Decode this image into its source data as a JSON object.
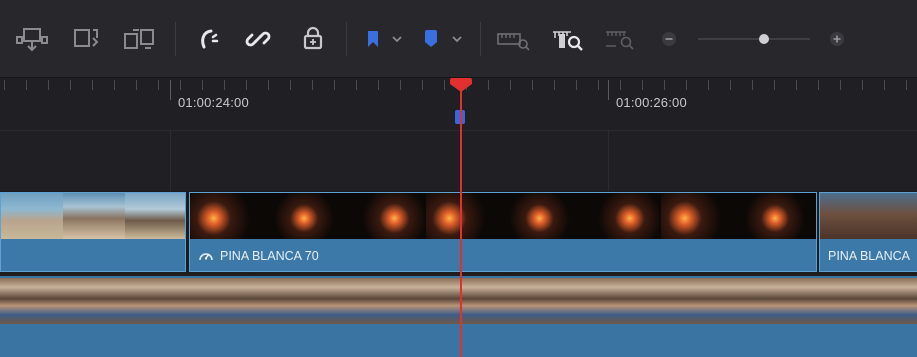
{
  "toolbar": {
    "icons": [
      "insert-clip-icon",
      "overwrite-clip-icon",
      "replace-clip-icon",
      "snapping-icon",
      "linked-selection-icon",
      "position-lock-icon",
      "flag-icon",
      "chevron-down-icon",
      "marker-icon",
      "chevron-down-icon",
      "zoom-full-icon",
      "zoom-detail-icon",
      "zoom-custom-icon",
      "zoom-out-icon",
      "zoom-in-icon"
    ],
    "zoom_level": 0.6
  },
  "ruler": {
    "timecode_1": "01:00:24:00",
    "timecode_2": "01:00:26:00"
  },
  "clips": {
    "clip_a_name": "",
    "clip_b_name": "PINA BLANCA 70",
    "clip_c_name": "PINA BLANCA"
  },
  "colors": {
    "clip_blue": "#3c79a8",
    "playhead_red": "#e0302f",
    "marker_blue": "#3a66d8",
    "flag_blue": "#3a6fe0"
  }
}
